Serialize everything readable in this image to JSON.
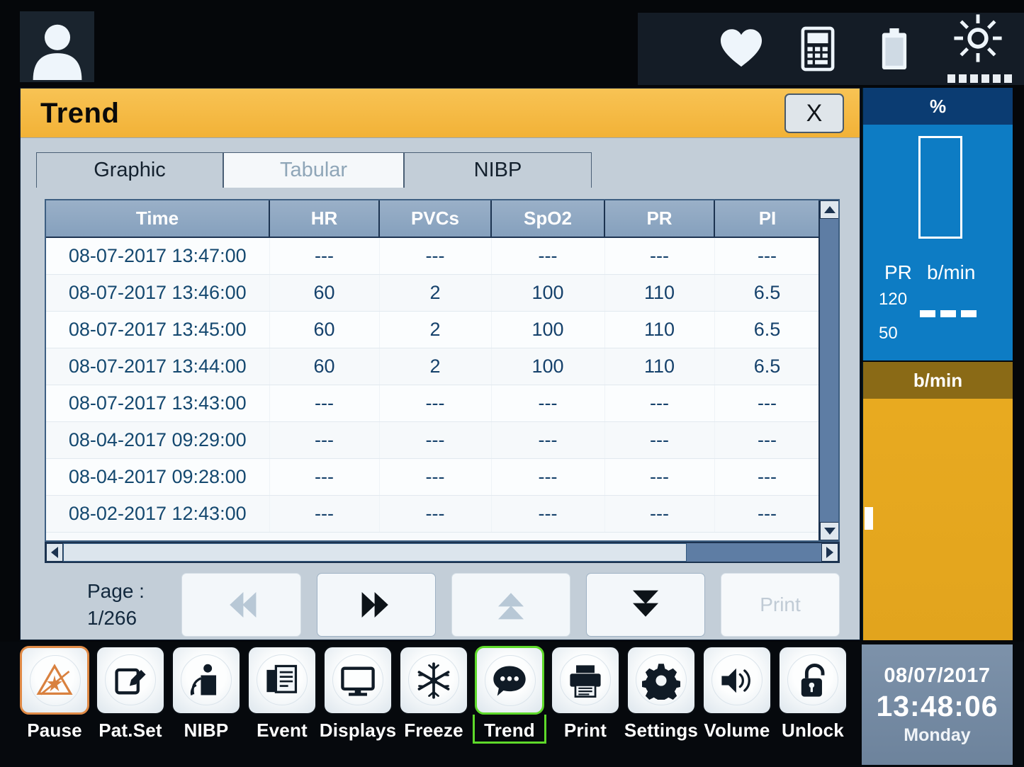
{
  "topbar": {
    "patient_icon": "patient-avatar-icon",
    "icons": [
      {
        "name": "heart-icon",
        "label": "Heart"
      },
      {
        "name": "nibp-module-icon",
        "label": "NIBP Module"
      },
      {
        "name": "battery-icon",
        "label": "Battery"
      },
      {
        "name": "brightness-icon",
        "label": "Brightness"
      }
    ],
    "brightness_levels": 6
  },
  "dialog": {
    "title": "Trend",
    "close_label": "X",
    "tabs": [
      {
        "id": "graphic",
        "label": "Graphic",
        "active": false
      },
      {
        "id": "tabular",
        "label": "Tabular",
        "active": true
      },
      {
        "id": "nibp",
        "label": "NIBP",
        "active": false
      }
    ],
    "table": {
      "headers": [
        "Time",
        "HR",
        "PVCs",
        "SpO2",
        "PR",
        "PI"
      ],
      "rows": [
        [
          "08-07-2017 13:47:00",
          "---",
          "---",
          "---",
          "---",
          "---"
        ],
        [
          "08-07-2017 13:46:00",
          "60",
          "2",
          "100",
          "110",
          "6.5"
        ],
        [
          "08-07-2017 13:45:00",
          "60",
          "2",
          "100",
          "110",
          "6.5"
        ],
        [
          "08-07-2017 13:44:00",
          "60",
          "2",
          "100",
          "110",
          "6.5"
        ],
        [
          "08-07-2017 13:43:00",
          "---",
          "---",
          "---",
          "---",
          "---"
        ],
        [
          "08-04-2017 09:29:00",
          "---",
          "---",
          "---",
          "---",
          "---"
        ],
        [
          "08-04-2017 09:28:00",
          "---",
          "---",
          "---",
          "---",
          "---"
        ],
        [
          "08-02-2017 12:43:00",
          "---",
          "---",
          "---",
          "---",
          "---"
        ]
      ]
    },
    "pagination": {
      "page_label": "Page :",
      "page_value": "1/266",
      "buttons": [
        {
          "name": "prev-page-button",
          "icon": "double-arrow-left-icon",
          "enabled": false
        },
        {
          "name": "next-page-button",
          "icon": "double-arrow-right-icon",
          "enabled": true
        },
        {
          "name": "scroll-up-button",
          "icon": "double-arrow-up-icon",
          "enabled": false
        },
        {
          "name": "scroll-down-button",
          "icon": "double-arrow-down-icon",
          "enabled": true
        }
      ],
      "print_label": "Print",
      "print_enabled": false
    }
  },
  "params": {
    "spo2": {
      "unit": "%",
      "value": "",
      "pr_label": "PR",
      "pr_unit": "b/min",
      "limit_high": "120",
      "limit_low": "50",
      "pr_value": "---",
      "color": "#0d7cc4",
      "header_color": "#0b3c72"
    },
    "pr": {
      "unit": "b/min",
      "value": "",
      "color": "#e8a91f",
      "header_color": "#8a6a16"
    }
  },
  "toolbar": {
    "items": [
      {
        "label": "Pause",
        "icon": "alarm-pause-icon",
        "state": "orange"
      },
      {
        "label": "Pat.Set",
        "icon": "edit-patient-icon",
        "state": "normal"
      },
      {
        "label": "NIBP",
        "icon": "nibp-cuff-icon",
        "state": "normal"
      },
      {
        "label": "Event",
        "icon": "documents-icon",
        "state": "normal"
      },
      {
        "label": "Displays",
        "icon": "monitor-icon",
        "state": "normal"
      },
      {
        "label": "Freeze",
        "icon": "snowflake-icon",
        "state": "normal"
      },
      {
        "label": "Trend",
        "icon": "trend-bubble-icon",
        "state": "green"
      },
      {
        "label": "Print",
        "icon": "printer-icon",
        "state": "normal"
      },
      {
        "label": "Settings",
        "icon": "gear-icon",
        "state": "normal"
      },
      {
        "label": "Volume",
        "icon": "speaker-icon",
        "state": "normal"
      },
      {
        "label": "Unlock",
        "icon": "unlock-icon",
        "state": "normal"
      }
    ]
  },
  "clock": {
    "date": "08/07/2017",
    "time": "13:48:06",
    "day": "Monday"
  }
}
